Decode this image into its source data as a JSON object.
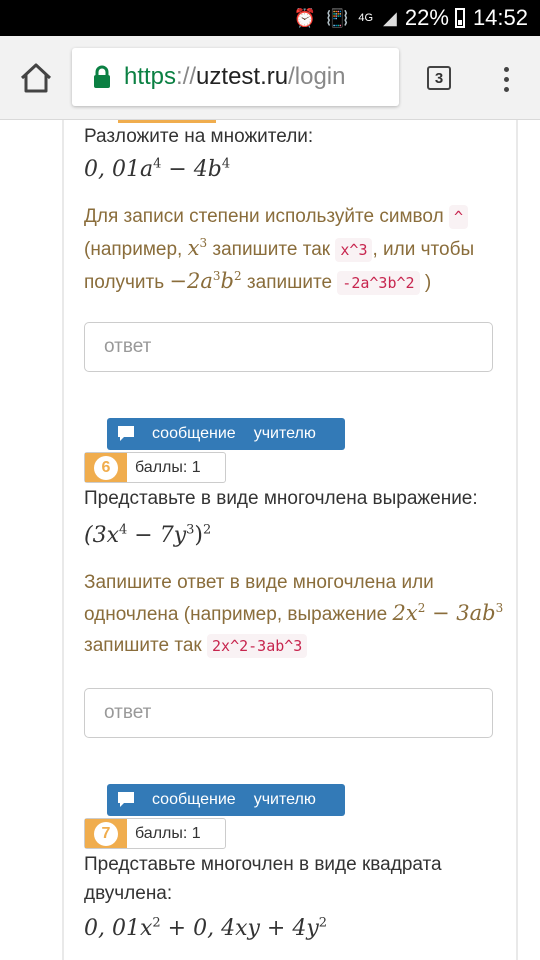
{
  "status_bar": {
    "network": "4G",
    "battery": "22%",
    "time": "14:52"
  },
  "browser": {
    "url_scheme": "https",
    "url_separator": "://",
    "url_host": "uztest.ru",
    "url_path": "/login",
    "tab_count": "3"
  },
  "questions": [
    {
      "prompt": "Разложите на множители:",
      "expr": {
        "a": "0, 01a",
        "a_pow": "4",
        "b": " − 4b",
        "b_pow": "4"
      },
      "hint": {
        "t1": "Для записи степени используйте символ ",
        "c1": "^",
        "t2": " (например, ",
        "m1": "x",
        "m1_pow": "3",
        "t3": " запишите так ",
        "c2": "x^3",
        "t4": ", или чтобы получить ",
        "m2a": "−2a",
        "m2a_pow": "3",
        "m2b": "b",
        "m2b_pow": "2",
        "t5": " запишите ",
        "c3": "-2a^3b^2",
        "t6": " )"
      },
      "answer_placeholder": "ответ"
    },
    {
      "message_button": {
        "word1": "сообщение",
        "word2": "учителю"
      },
      "number": "6",
      "points": "баллы: 1",
      "prompt": "Представьте в виде многочлена выражение:",
      "expr": {
        "open": "(3x",
        "x_pow": "4",
        "mid": " − 7y",
        "y_pow": "3",
        "close": ")",
        "outer_pow": "2"
      },
      "hint": {
        "t1": "Запишите ответ в виде многочлена или одночлена (например, выражение ",
        "m1": "2x",
        "m1_pow": "2",
        "m2": " − 3ab",
        "m2_pow": "3",
        "t2": " запишите так ",
        "c1": "2x^2-3ab^3"
      },
      "answer_placeholder": "ответ"
    },
    {
      "message_button": {
        "word1": "сообщение",
        "word2": "учителю"
      },
      "number": "7",
      "points": "баллы: 1",
      "prompt": "Представьте многочлен в виде квадрата двучлена:",
      "expr": {
        "a": "0, 01x",
        "a_pow": "2",
        "b": " + 0, 4xy + 4y",
        "b_pow": "2"
      }
    }
  ]
}
